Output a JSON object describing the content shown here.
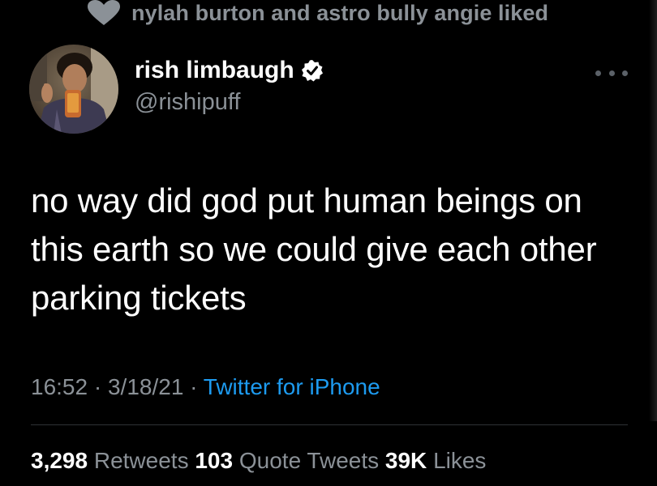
{
  "social_context": {
    "text": "nylah burton and astro bully angie liked",
    "icon": "heart-icon"
  },
  "author": {
    "name": "rish limbaugh",
    "handle": "@rishipuff",
    "verified": true
  },
  "tweet": {
    "text": "no way did god put human beings on this earth so we could give each other parking tickets"
  },
  "meta": {
    "time": "16:52",
    "separator1": " · ",
    "date": "3/18/21",
    "separator2": " · ",
    "source": "Twitter for iPhone"
  },
  "stats": {
    "retweets_count": "3,298",
    "retweets_label": "Retweets",
    "quotes_count": "103",
    "quotes_label": "Quote Tweets",
    "likes_count": "39K",
    "likes_label": "Likes"
  },
  "colors": {
    "background": "#000000",
    "primary_text": "#ffffff",
    "secondary_text": "#8b9197",
    "link": "#1d9bf0"
  }
}
